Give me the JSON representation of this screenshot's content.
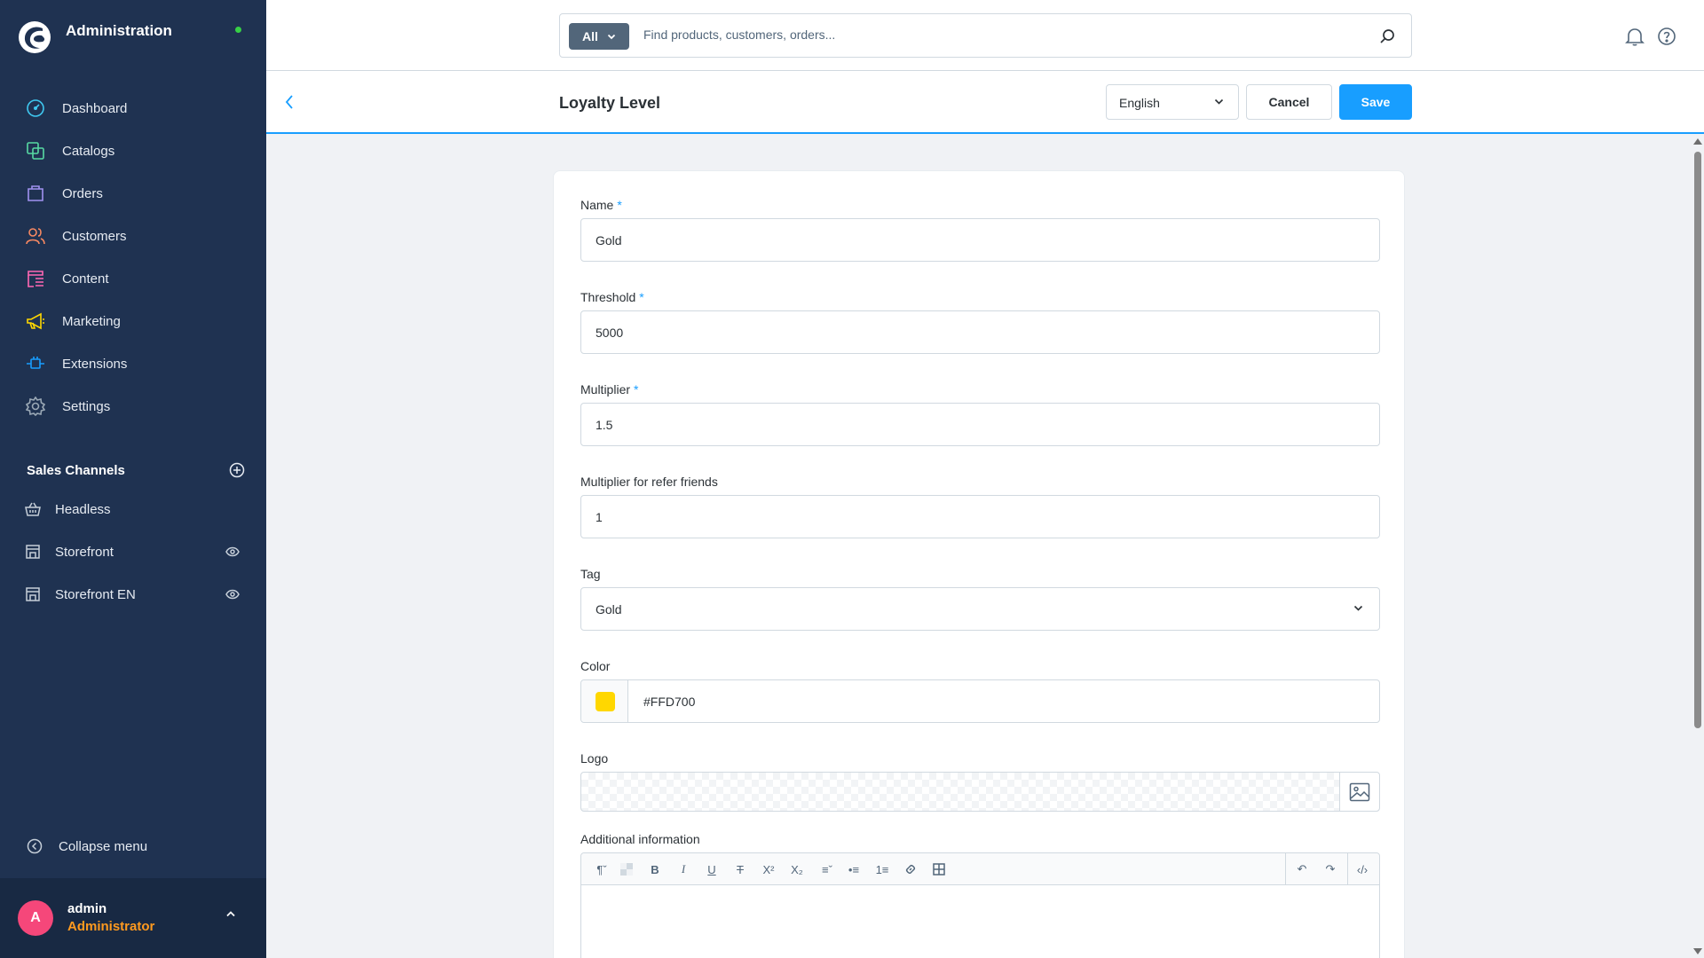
{
  "app": {
    "title": "Administration",
    "status_color": "#37d046"
  },
  "nav": [
    {
      "label": "Dashboard",
      "icon": "dashboard-icon",
      "color": "#3fc8f0"
    },
    {
      "label": "Catalogs",
      "icon": "catalogs-icon",
      "color": "#57d9a3"
    },
    {
      "label": "Orders",
      "icon": "orders-icon",
      "color": "#a092f0"
    },
    {
      "label": "Customers",
      "icon": "customers-icon",
      "color": "#f88962"
    },
    {
      "label": "Content",
      "icon": "content-icon",
      "color": "#ff68b4"
    },
    {
      "label": "Marketing",
      "icon": "marketing-icon",
      "color": "#ffd700"
    },
    {
      "label": "Extensions",
      "icon": "extensions-icon",
      "color": "#189eff"
    },
    {
      "label": "Settings",
      "icon": "settings-icon",
      "color": "#9aa8b5"
    }
  ],
  "sales_channels": {
    "title": "Sales Channels",
    "items": [
      {
        "label": "Headless",
        "icon": "basket-icon",
        "visible_toggle": false
      },
      {
        "label": "Storefront",
        "icon": "storefront-icon",
        "visible_toggle": true
      },
      {
        "label": "Storefront EN",
        "icon": "storefront-icon",
        "visible_toggle": true
      }
    ]
  },
  "collapse_label": "Collapse menu",
  "user": {
    "initial": "A",
    "name": "admin",
    "role": "Administrator"
  },
  "search": {
    "scope": "All",
    "placeholder": "Find products, customers, orders..."
  },
  "smartbar": {
    "title": "Loyalty Level",
    "language": "English",
    "cancel_label": "Cancel",
    "save_label": "Save"
  },
  "form": {
    "name": {
      "label": "Name",
      "required": "*",
      "value": "Gold"
    },
    "threshold": {
      "label": "Threshold",
      "required": "*",
      "value": "5000"
    },
    "multiplier": {
      "label": "Multiplier",
      "required": "*",
      "value": "1.5"
    },
    "refer_multiplier": {
      "label": "Multiplier for refer friends",
      "value": "1"
    },
    "tag": {
      "label": "Tag",
      "value": "Gold"
    },
    "color": {
      "label": "Color",
      "value": "#FFD700",
      "swatch": "#FFD700"
    },
    "logo": {
      "label": "Logo"
    },
    "additional_info": {
      "label": "Additional information"
    }
  },
  "colors": {
    "accent": "#189eff",
    "sidebar": "#1f3251",
    "user_bar": "#182943",
    "role": "#ff9a1f",
    "avatar": "#f5477a"
  }
}
